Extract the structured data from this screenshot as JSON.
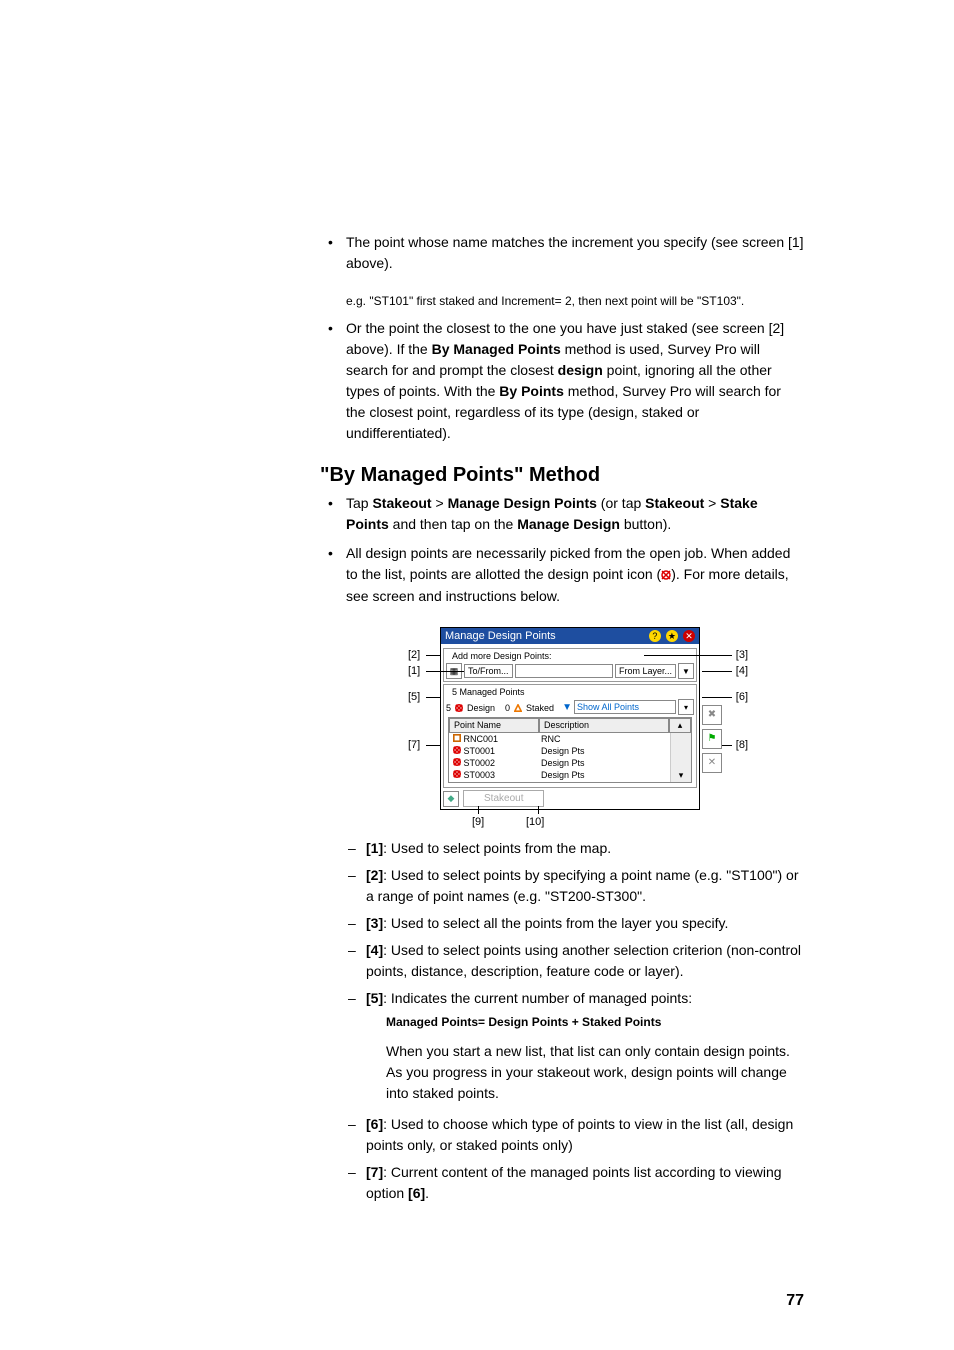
{
  "top": {
    "bullet1": "The point whose name matches the increment you specify (see screen [1] above).",
    "example": "e.g. \"ST101\" first staked and Increment= 2, then next point will be \"ST103\".",
    "bullet2_a": "Or the point the closest to the one you have just staked (see screen [2] above). If the ",
    "bullet2_b": "By Managed Points",
    "bullet2_c": " method is used, Survey Pro will search for and prompt the closest ",
    "bullet2_d": "design",
    "bullet2_e": " point, ignoring all the other types of points. With the ",
    "bullet2_f": "By Points",
    "bullet2_g": " method, Survey Pro will search for the closest point, regardless of its type (design, staked or undifferentiated)."
  },
  "heading": "\"By Managed Points\" Method",
  "mb": {
    "b1_a": "Tap ",
    "b1_b": "Stakeout",
    "b1_c": " > ",
    "b1_d": "Manage Design Points",
    "b1_e": " (or tap ",
    "b1_f": "Stakeout",
    "b1_g": " > ",
    "b1_h": "Stake Points",
    "b1_i": " and then tap on the ",
    "b1_j": "Manage Design",
    "b1_k": " button).",
    "b2_a": "All design points are necessarily picked from the open job. When added to the list, points are allotted the design point icon (",
    "b2_b": "). For more details, see screen and instructions below."
  },
  "ui": {
    "title": "Manage Design Points",
    "add_section": "Add more Design Points:",
    "tofrom": "To/From...",
    "fromlayer": "From Layer...",
    "mp_section": "5 Managed Points",
    "legend_design_n": "5",
    "legend_design": "Design",
    "legend_staked_n": "0",
    "legend_staked": "Staked",
    "filter": "Show All Points",
    "col_name": "Point Name",
    "col_desc": "Description",
    "rows": [
      {
        "name": "RNC001",
        "desc": "RNC"
      },
      {
        "name": "ST0001",
        "desc": "Design Pts"
      },
      {
        "name": "ST0002",
        "desc": "Design Pts"
      },
      {
        "name": "ST0003",
        "desc": "Design Pts"
      }
    ],
    "stakeout_btn": "Stakeout",
    "callouts": {
      "c1": "[1]",
      "c2": "[2]",
      "c3": "[3]",
      "c4": "[4]",
      "c5": "[5]",
      "c6": "[6]",
      "c7": "[7]",
      "c8": "[8]",
      "c9": "[9]",
      "c10": "[10]"
    }
  },
  "desc": {
    "d1_a": "[1]",
    "d1_b": ": Used to select points from the map.",
    "d2_a": "[2]",
    "d2_b": ": Used to select points by specifying a point name (e.g. \"ST100\") or a range of point names (e.g. \"ST200-ST300\".",
    "d3_a": "[3]",
    "d3_b": ": Used to select all the points from the layer you specify.",
    "d4_a": "[4]",
    "d4_b": ": Used to select points using another selection criterion (non-control points, distance, description, feature code or layer).",
    "d5_a": "[5]",
    "d5_b": ": Indicates the current number of managed points:",
    "d5_formula": "Managed Points= Design Points + Staked Points",
    "d5_note": "When you start a new list, that list can only contain design points. As you progress in your stakeout work, design points will change into staked points.",
    "d6_a": "[6]",
    "d6_b": ": Used to choose which type of points to view in the list (all, design points only, or staked points only)",
    "d7_a": "[7]",
    "d7_b": ": Current content of the managed points list according to viewing option ",
    "d7_c": "[6]",
    "d7_d": "."
  },
  "page_num": "77"
}
